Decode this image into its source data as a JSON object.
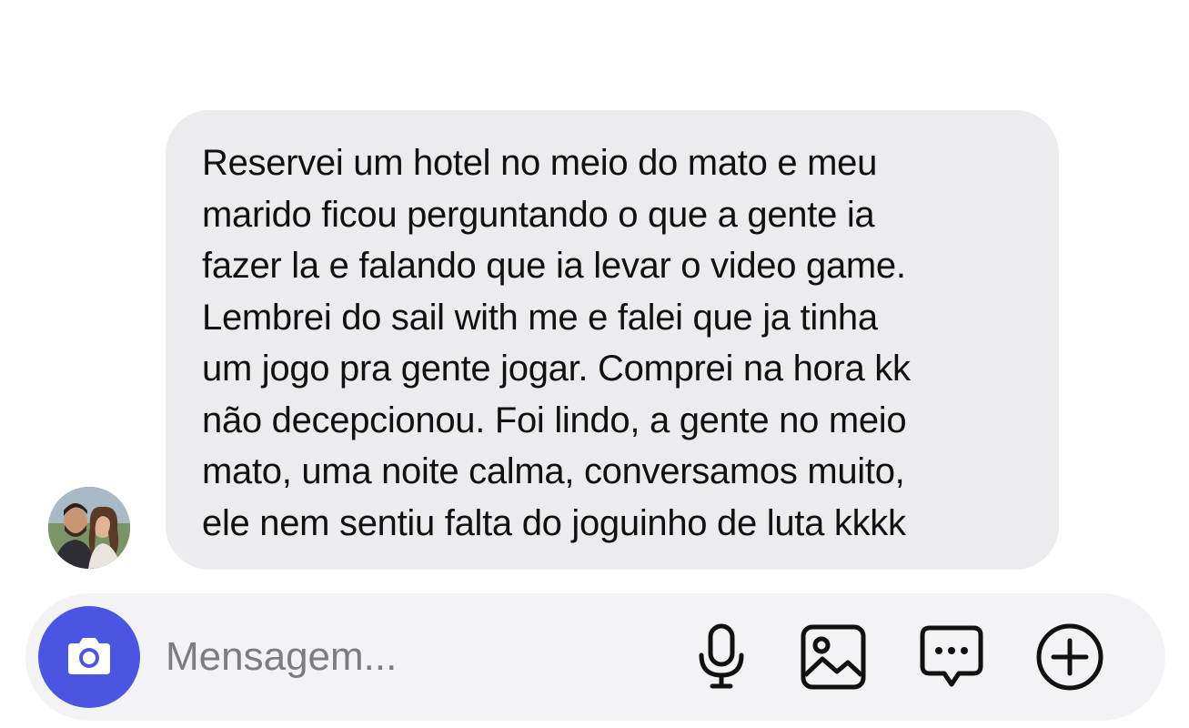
{
  "conversation": {
    "avatar_alt": "avatar",
    "message": {
      "lines": [
        "Reservei um hotel no meio do mato e meu",
        "marido ficou perguntando o que a gente ia",
        "fazer la e falando que ia levar o video game.",
        "Lembrei do sail with me e falei que ja tinha",
        "um jogo pra gente jogar. Comprei na hora kk",
        "não decepcionou. Foi lindo, a gente no meio",
        "mato, uma noite calma, conversamos muito,",
        "ele nem sentiu falta do joguinho de luta kkkk"
      ]
    }
  },
  "composer": {
    "placeholder": "Mensagem...",
    "value": "",
    "icons": {
      "camera": "camera-icon",
      "mic": "microphone-icon",
      "gallery": "image-icon",
      "sticker": "chat-bubble-icon",
      "add": "plus-circle-icon"
    }
  },
  "colors": {
    "bubble": "#ececee",
    "composer": "#f3f3f5",
    "camera_button": "#4a56e2",
    "icon": "#111111",
    "placeholder": "#7d7d80"
  }
}
